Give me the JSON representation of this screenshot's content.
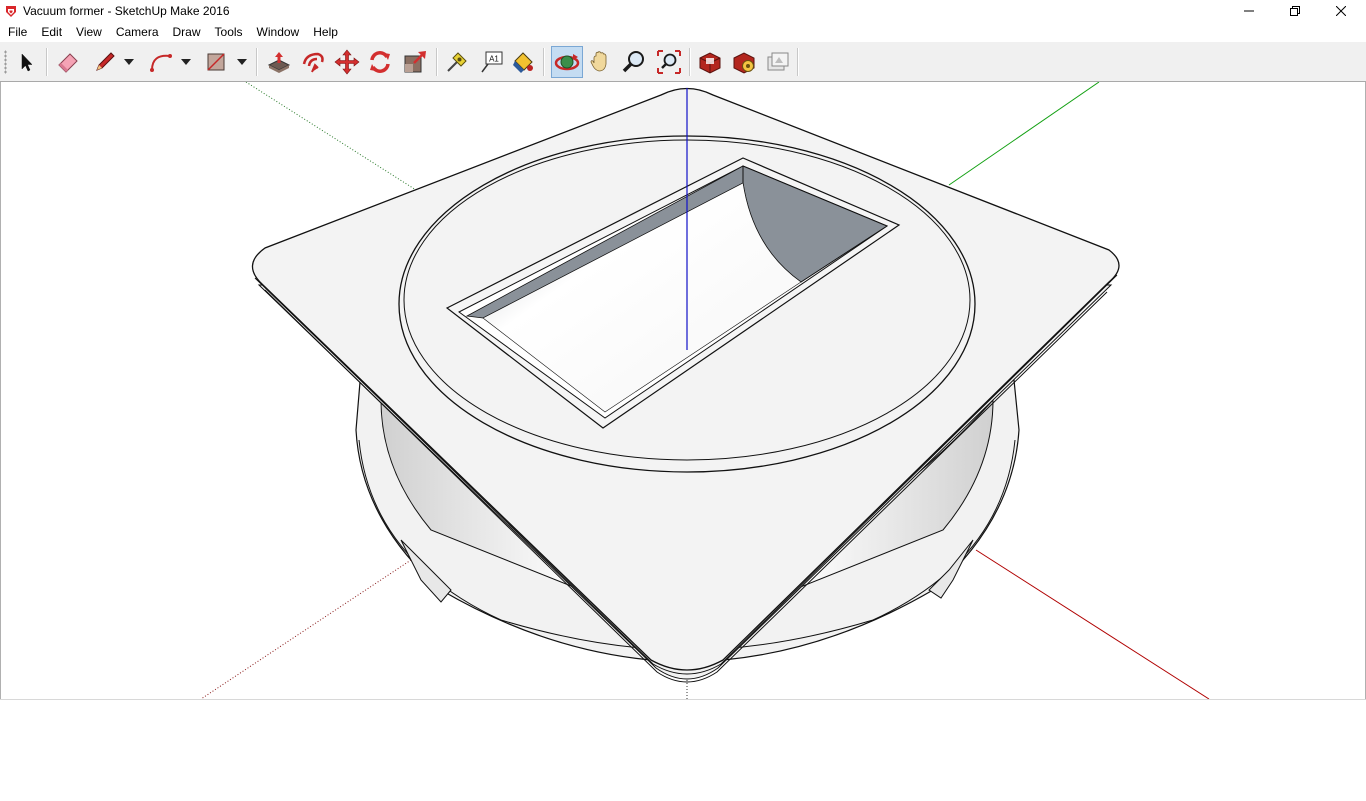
{
  "window": {
    "title": "Vacuum former - SketchUp Make 2016",
    "app_icon": "sketchup-logo-icon",
    "controls": [
      "minimize-icon",
      "restore-icon",
      "close-icon"
    ]
  },
  "menubar": {
    "items": [
      "File",
      "Edit",
      "View",
      "Camera",
      "Draw",
      "Tools",
      "Window",
      "Help"
    ]
  },
  "toolbar": {
    "tools": [
      {
        "name": "select-tool",
        "icon": "arrow-cursor-icon"
      },
      {
        "name": "eraser-tool",
        "icon": "eraser-icon"
      },
      {
        "name": "line-tool",
        "icon": "pencil-icon"
      },
      {
        "name": "arc-tool",
        "icon": "arc-icon"
      },
      {
        "name": "rectangle-tool",
        "icon": "rectangle-icon"
      },
      {
        "name": "push-pull-tool",
        "icon": "push-pull-icon"
      },
      {
        "name": "offset-tool",
        "icon": "offset-icon"
      },
      {
        "name": "move-tool",
        "icon": "move-arrows-icon"
      },
      {
        "name": "rotate-tool",
        "icon": "rotate-icon"
      },
      {
        "name": "scale-tool",
        "icon": "scale-icon"
      },
      {
        "name": "tape-measure-tool",
        "icon": "tape-measure-icon"
      },
      {
        "name": "text-tool",
        "icon": "text-label-icon"
      },
      {
        "name": "paint-bucket-tool",
        "icon": "paint-bucket-icon"
      },
      {
        "name": "orbit-tool",
        "icon": "orbit-icon"
      },
      {
        "name": "pan-tool",
        "icon": "hand-icon"
      },
      {
        "name": "zoom-tool",
        "icon": "magnifier-icon"
      },
      {
        "name": "zoom-extents-tool",
        "icon": "zoom-extents-icon"
      },
      {
        "name": "3d-warehouse-tool",
        "icon": "warehouse-icon"
      },
      {
        "name": "extension-warehouse-tool",
        "icon": "extension-icon"
      },
      {
        "name": "send-to-layout-tool",
        "icon": "layout-icon"
      }
    ],
    "text_tool_label": "A1",
    "active_tool": "orbit-tool"
  },
  "colors": {
    "model_face": "#f2f2f2",
    "shadow_face": "#8a9199",
    "red_axis": "#a00000",
    "green_axis": "#00a000",
    "blue_axis": "#0000c8",
    "toolbar_bg": "#f0f0f0"
  }
}
